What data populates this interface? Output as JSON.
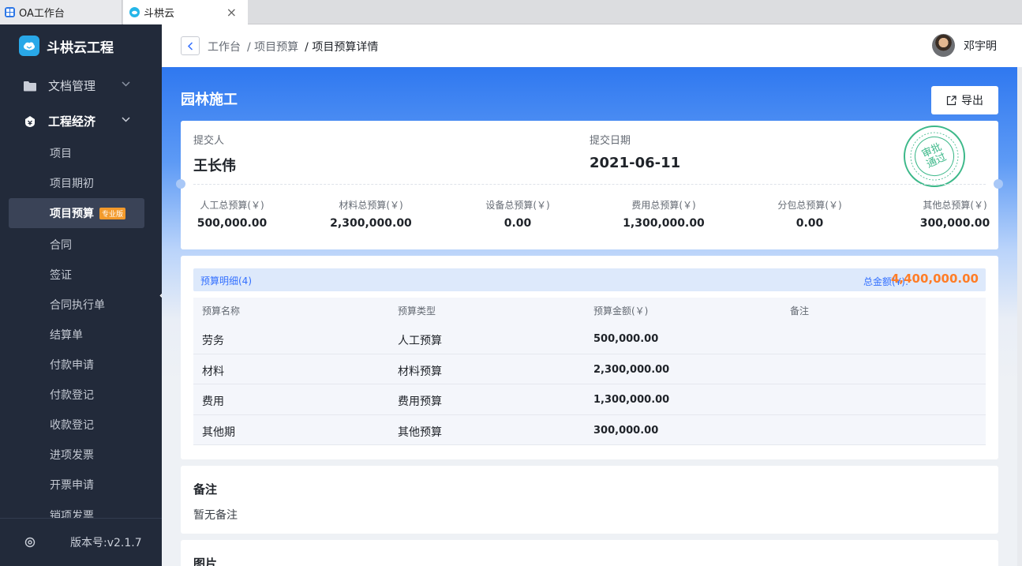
{
  "browser": {
    "tabs": [
      {
        "label": "OA工作台"
      },
      {
        "label": "斗栱云",
        "close": "×"
      }
    ]
  },
  "sidebar": {
    "app_name": "斗栱云工程",
    "groups": [
      {
        "label": "文档管理",
        "icon": "folder-icon"
      },
      {
        "label": "工程经济",
        "icon": "economy-icon"
      }
    ],
    "items": [
      {
        "label": "项目"
      },
      {
        "label": "项目期初"
      },
      {
        "label": "项目预算",
        "badge": "专业版"
      },
      {
        "label": "合同"
      },
      {
        "label": "签证"
      },
      {
        "label": "合同执行单"
      },
      {
        "label": "结算单"
      },
      {
        "label": "付款申请"
      },
      {
        "label": "付款登记"
      },
      {
        "label": "收款登记"
      },
      {
        "label": "进项发票"
      },
      {
        "label": "开票申请"
      },
      {
        "label": "销项发票"
      }
    ],
    "version": "版本号:v2.1.7"
  },
  "header": {
    "breadcrumb": [
      "工作台",
      "/ 项目预算",
      "/ 项目预算详情"
    ],
    "user_name": "邓宇明"
  },
  "page": {
    "title": "园林施工",
    "export_label": "导出",
    "submitter_label": "提交人",
    "submitter": "王长伟",
    "date_label": "提交日期",
    "date": "2021-06-11",
    "stamp_text": [
      "审批",
      "通过"
    ],
    "stats": [
      {
        "label": "人工总预算(￥)",
        "value": "500,000.00"
      },
      {
        "label": "材料总预算(￥)",
        "value": "2,300,000.00"
      },
      {
        "label": "设备总预算(￥)",
        "value": "0.00"
      },
      {
        "label": "费用总预算(￥)",
        "value": "1,300,000.00"
      },
      {
        "label": "分包总预算(￥)",
        "value": "0.00"
      },
      {
        "label": "其他总预算(￥)",
        "value": "300,000.00"
      }
    ],
    "detail": {
      "title": "预算明细(4)",
      "total_label": "总金额(¥):",
      "total": "4,400,000.00",
      "columns": [
        "预算名称",
        "预算类型",
        "预算金额(￥)",
        "备注"
      ],
      "rows": [
        {
          "name": "劳务",
          "type": "人工预算",
          "amount": "500,000.00",
          "note": ""
        },
        {
          "name": "材料",
          "type": "材料预算",
          "amount": "2,300,000.00",
          "note": ""
        },
        {
          "name": "费用",
          "type": "费用预算",
          "amount": "1,300,000.00",
          "note": ""
        },
        {
          "name": "其他期",
          "type": "其他预算",
          "amount": "300,000.00",
          "note": ""
        }
      ]
    },
    "note_title": "备注",
    "note_text": "暂无备注",
    "images_title": "图片"
  },
  "colors": {
    "accent": "#3370ff",
    "total": "#ff7d28",
    "sidebar_bg": "#222a3a",
    "stamp": "#3cb889"
  }
}
